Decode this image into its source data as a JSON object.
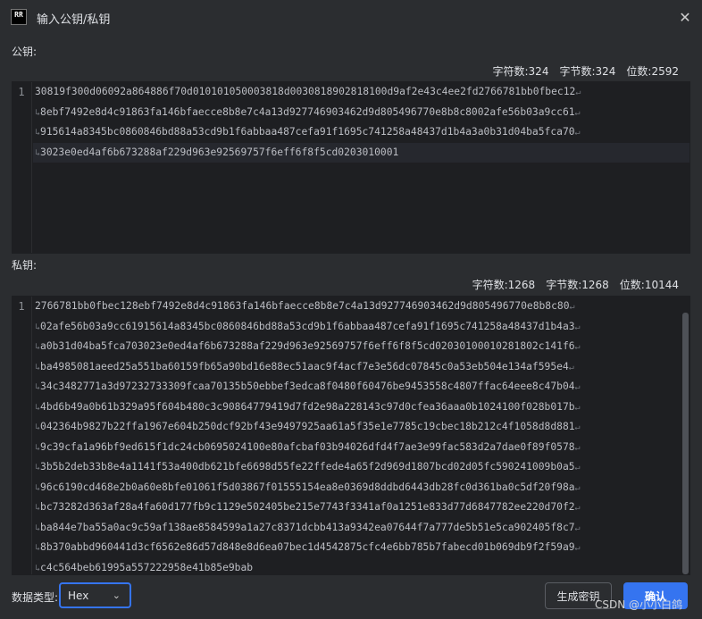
{
  "window": {
    "logo_text": "RR",
    "title": "输入公钥/私钥",
    "close_icon": "close-icon"
  },
  "public_key": {
    "label": "公钥:",
    "stats": {
      "chars": "字符数:324",
      "bytes": "字节数:324",
      "bits": "位数:2592"
    },
    "line_number": "1",
    "lines": [
      "30819f300d06092a864886f70d010101050003818d0030818902818100d9af2e43c4ee2fd2766781bb0fbec12",
      "8ebf7492e8d4c91863fa146bfaecce8b8e7c4a13d927746903462d9d805496770e8b8c8002afe56b03a9cc61",
      "915614a8345bc0860846bd88a53cd9b1f6abbaa487cefa91f1695c741258a48437d1b4a3a0b31d04ba5fca70",
      "3023e0ed4af6b673288af229d963e92569757f6eff6f8f5cd0203010001"
    ]
  },
  "private_key": {
    "label": "私钥:",
    "stats": {
      "chars": "字符数:1268",
      "bytes": "字节数:1268",
      "bits": "位数:10144"
    },
    "line_number": "1",
    "lines": [
      "2766781bb0fbec128ebf7492e8d4c91863fa146bfaecce8b8e7c4a13d927746903462d9d805496770e8b8c80",
      "02afe56b03a9cc61915614a8345bc0860846bd88a53cd9b1f6abbaa487cefa91f1695c741258a48437d1b4a3",
      "a0b31d04ba5fca703023e0ed4af6b673288af229d963e92569757f6eff6f8f5cd02030100010281802c141f6",
      "ba4985081aeed25a551ba60159fb65a90bd16e88ec51aac9f4acf7e3e56dc07845c0a53eb504e134af595e4",
      "34c3482771a3d97232733309fcaa70135b50ebbef3edca8f0480f60476be9453558c4807ffac64eee8c47b04",
      "4bd6b49a0b61b329a95f604b480c3c90864779419d7fd2e98a228143c97d0cfea36aaa0b1024100f028b017b",
      "042364b9827b22ffa1967e604b250dcf92bf43e9497925aa61a5f35e1e7785c19cbec18b212c4f1058d8d881",
      "9c39cfa1a96bf9ed615f1dc24cb0695024100e80afcbaf03b94026dfd4f7ae3e99fac583d2a7dae0f89f0578",
      "3b5b2deb33b8e4a1141f53a400db621bfe6698d55fe22ffede4a65f2d969d1807bcd02d05fc590241009b0a5",
      "96c6190cd468e2b0a60e8bfe01061f5d03867f01555154ea8e0369d8ddbd6443db28fc0d361ba0c5df20f98a",
      "bc73282d363af28a4fa60d177fb9c1129e502405be215e7743f3341af0a1251e833d77d6847782ee220d70f2",
      "ba844e7ba55a0ac9c59af138ae8584599a1a27c8371dcbb413a9342ea07644f7a777de5b51e5ca902405f8c7",
      "8b370abbd960441d3cf6562e86d57d848e8d6ea07bec1d4542875cfc4e6bb785b7fabecd01b069db9f2f59a9",
      "c4c564beb61995a557222958e41b85e9bab"
    ]
  },
  "bottom": {
    "data_type_label": "数据类型:",
    "data_type_value": "Hex",
    "generate_button": "生成密钥",
    "ok_button": "确认"
  },
  "watermark": "CSDN @小小白鸽"
}
